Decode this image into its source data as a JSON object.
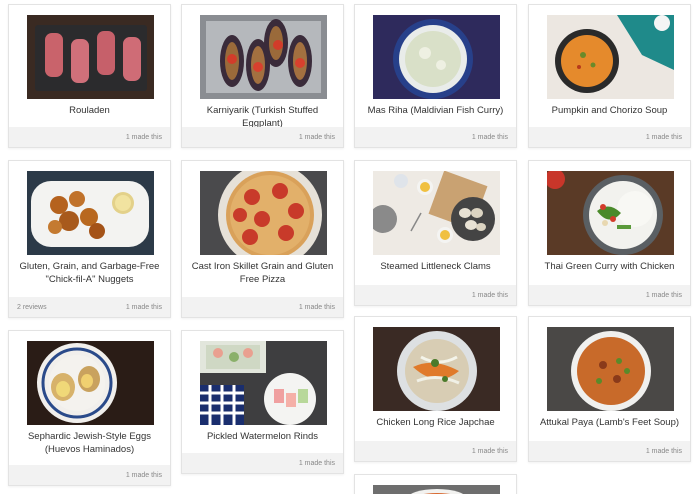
{
  "cards": [
    {
      "title": "Rouladen",
      "made": "1 made this",
      "image": "rouladen-photo"
    },
    {
      "title": "Karniyarik (Turkish Stuffed Eggplant)",
      "made": "1 made this",
      "image": "stuffed-eggplant-photo"
    },
    {
      "title": "Mas Riha (Maldivian Fish Curry)",
      "made": "1 made this",
      "image": "fish-curry-photo"
    },
    {
      "title": "Pumpkin and Chorizo Soup",
      "made": "1 made this",
      "image": "pumpkin-soup-photo"
    },
    {
      "title": "Gluten, Grain, and Garbage-Free \"Chick-fil-A\" Nuggets",
      "made": "1 made this",
      "reviews": "2 reviews",
      "image": "nuggets-photo"
    },
    {
      "title": "Cast Iron Skillet Grain and Gluten Free Pizza",
      "made": "1 made this",
      "image": "pizza-photo"
    },
    {
      "title": "Steamed Littleneck Clams",
      "made": "1 made this",
      "image": "clams-photo"
    },
    {
      "title": "Thai Green Curry with Chicken",
      "made": "1 made this",
      "image": "green-curry-photo"
    },
    {
      "title": "Sephardic Jewish-Style Eggs (Huevos Haminados)",
      "made": "1 made this",
      "image": "eggs-photo"
    },
    {
      "title": "Pickled Watermelon Rinds",
      "made": "1 made this",
      "image": "watermelon-rinds-photo"
    },
    {
      "title": "Chicken Long Rice Japchae",
      "made": "1 made this",
      "image": "japchae-photo"
    },
    {
      "title": "Attukal Paya (Lamb's Feet Soup)",
      "made": "1 made this",
      "image": "lamb-feet-soup-photo"
    },
    {
      "title": "",
      "made": "",
      "image": "soup-bowl-photo"
    }
  ]
}
